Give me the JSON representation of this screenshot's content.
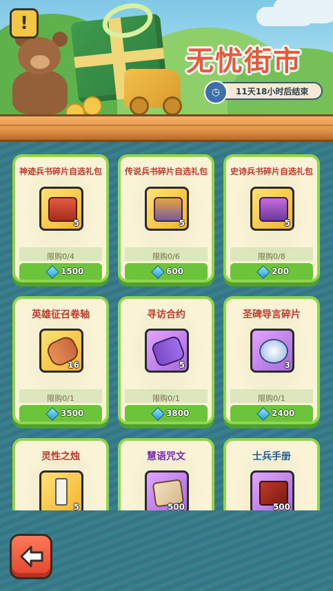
{
  "banner": {
    "title": "无忧街市",
    "timer_text": "11天18小时后结束",
    "timer_icon": "clock-icon",
    "info_button_label": "!"
  },
  "cards": [
    {
      "name": "神迹兵书碎片自选礼包",
      "qty": "5",
      "limit": "限购0/4",
      "price": "1500",
      "icon": "red-chest"
    },
    {
      "name": "传说兵书碎片自选礼包",
      "qty": "5",
      "limit": "限购0/6",
      "price": "600",
      "icon": "gold-chest"
    },
    {
      "name": "史诗兵书碎片自选礼包",
      "qty": "5",
      "limit": "限购0/8",
      "price": "200",
      "icon": "purple-chest"
    },
    {
      "name": "英雄征召卷轴",
      "qty": "16",
      "limit": "限购0/1",
      "price": "3500",
      "icon": "scroll"
    },
    {
      "name": "寻访合约",
      "qty": "5",
      "limit": "限购0/1",
      "price": "3800",
      "icon": "contract"
    },
    {
      "name": "圣碑导言碎片",
      "qty": "3",
      "limit": "限购0/1",
      "price": "2400",
      "icon": "stone-fragment"
    },
    {
      "name": "灵性之烛",
      "qty": "5",
      "limit": "",
      "price": "",
      "icon": "candle"
    },
    {
      "name": "慧语咒文",
      "qty": "500",
      "limit": "",
      "price": "",
      "icon": "rune-scroll"
    },
    {
      "name": "士兵手册",
      "qty": "500",
      "limit": "",
      "price": "",
      "icon": "manual-book"
    }
  ],
  "colors": {
    "card_border": "#8fd64a",
    "price_bar": "#6cc43a",
    "title": "#e85a3a",
    "name_red": "#c0392b",
    "name_purple": "#7a2ab8",
    "name_blue": "#1a5a9a"
  },
  "back_button_icon": "back-arrow-icon"
}
